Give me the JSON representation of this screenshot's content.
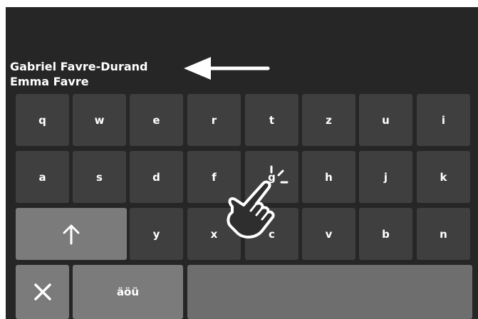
{
  "contacts": [
    {
      "name": "Gabriel Favre-Durand"
    },
    {
      "name": "Emma Favre"
    }
  ],
  "keyboard": {
    "row1": [
      "q",
      "w",
      "e",
      "r",
      "t",
      "z",
      "u",
      "i"
    ],
    "row2": [
      "a",
      "s",
      "d",
      "f",
      "g",
      "h",
      "j",
      "k"
    ],
    "row3": [
      "y",
      "x",
      "c",
      "v",
      "b",
      "n"
    ],
    "umlaut_label": "äöü",
    "shift_icon": "arrow-up-icon",
    "delete_icon": "close-icon"
  },
  "annotations": {
    "arrow_icon": "arrow-left-icon",
    "gesture_icon": "tap-hand-icon"
  },
  "colors": {
    "background": "#262626",
    "key": "#3f3f3f",
    "key_special": "#7b7b7b",
    "text": "#ffffff"
  }
}
